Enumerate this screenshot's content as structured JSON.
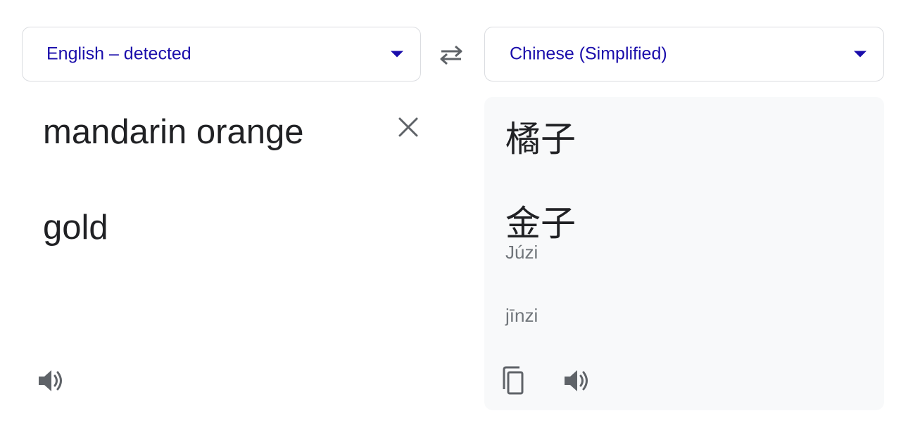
{
  "source_language": {
    "label": "English – detected"
  },
  "target_language": {
    "label": "Chinese (Simplified)"
  },
  "source_text": {
    "lines": [
      "mandarin orange",
      "gold"
    ]
  },
  "translation": {
    "lines": [
      "橘子",
      "金子"
    ],
    "transliterations": [
      "Júzi",
      "jīnzi"
    ]
  },
  "icons": {
    "dropdown": "caret-down-icon",
    "swap": "swap-arrows-icon",
    "clear": "close-icon",
    "speaker": "speaker-icon",
    "copy": "copy-icon"
  },
  "colors": {
    "accent": "#1a0dab",
    "text": "#202124",
    "muted": "#70757a",
    "icon": "#5f6368",
    "target_background": "#f8f9fa",
    "border": "#dadce0"
  }
}
